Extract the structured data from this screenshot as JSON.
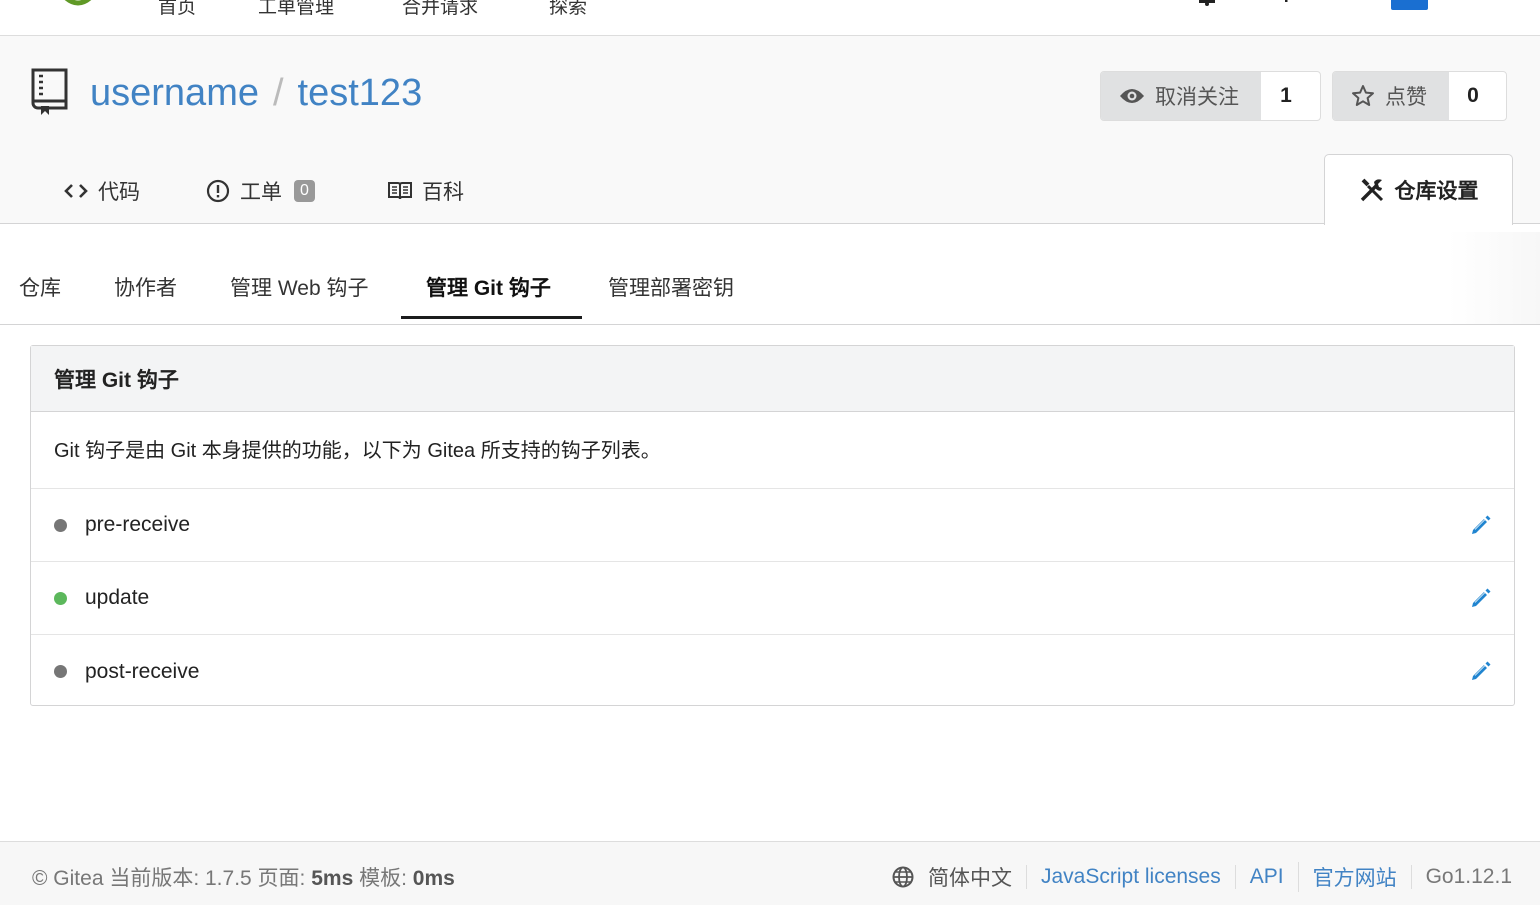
{
  "topnav": {
    "items": [
      "首页",
      "工单管理",
      "合并请求",
      "探索"
    ]
  },
  "repo": {
    "owner": "username",
    "separator": "/",
    "name": "test123",
    "watch": {
      "label": "取消关注",
      "count": "1"
    },
    "star": {
      "label": "点赞",
      "count": "0"
    }
  },
  "tabs": {
    "code": "代码",
    "issues": "工单",
    "issues_count": "0",
    "wiki": "百科",
    "settings": "仓库设置"
  },
  "submenu": {
    "items": [
      "仓库",
      "协作者",
      "管理 Web 钩子",
      "管理 Git 钩子",
      "管理部署密钥"
    ],
    "active": "管理 Git 钩子"
  },
  "segment": {
    "title": "管理 Git 钩子",
    "description": "Git 钩子是由 Git 本身提供的功能，以下为 Gitea 所支持的钩子列表。",
    "hooks": [
      {
        "name": "pre-receive",
        "status_color": "#767676"
      },
      {
        "name": "update",
        "status_color": "#5cb85c"
      },
      {
        "name": "post-receive",
        "status_color": "#767676"
      }
    ]
  },
  "footer": {
    "copyright": "© Gitea 当前版本: 1.7.5 页面: ",
    "page_time": "5ms",
    "template_label": " 模板: ",
    "template_time": "0ms",
    "language": "简体中文",
    "js_licenses": "JavaScript licenses",
    "api": "API",
    "website": "官方网站",
    "go_version": "Go1.12.1"
  },
  "colors": {
    "link": "#4183c4",
    "edit_icon": "#2185d0"
  }
}
